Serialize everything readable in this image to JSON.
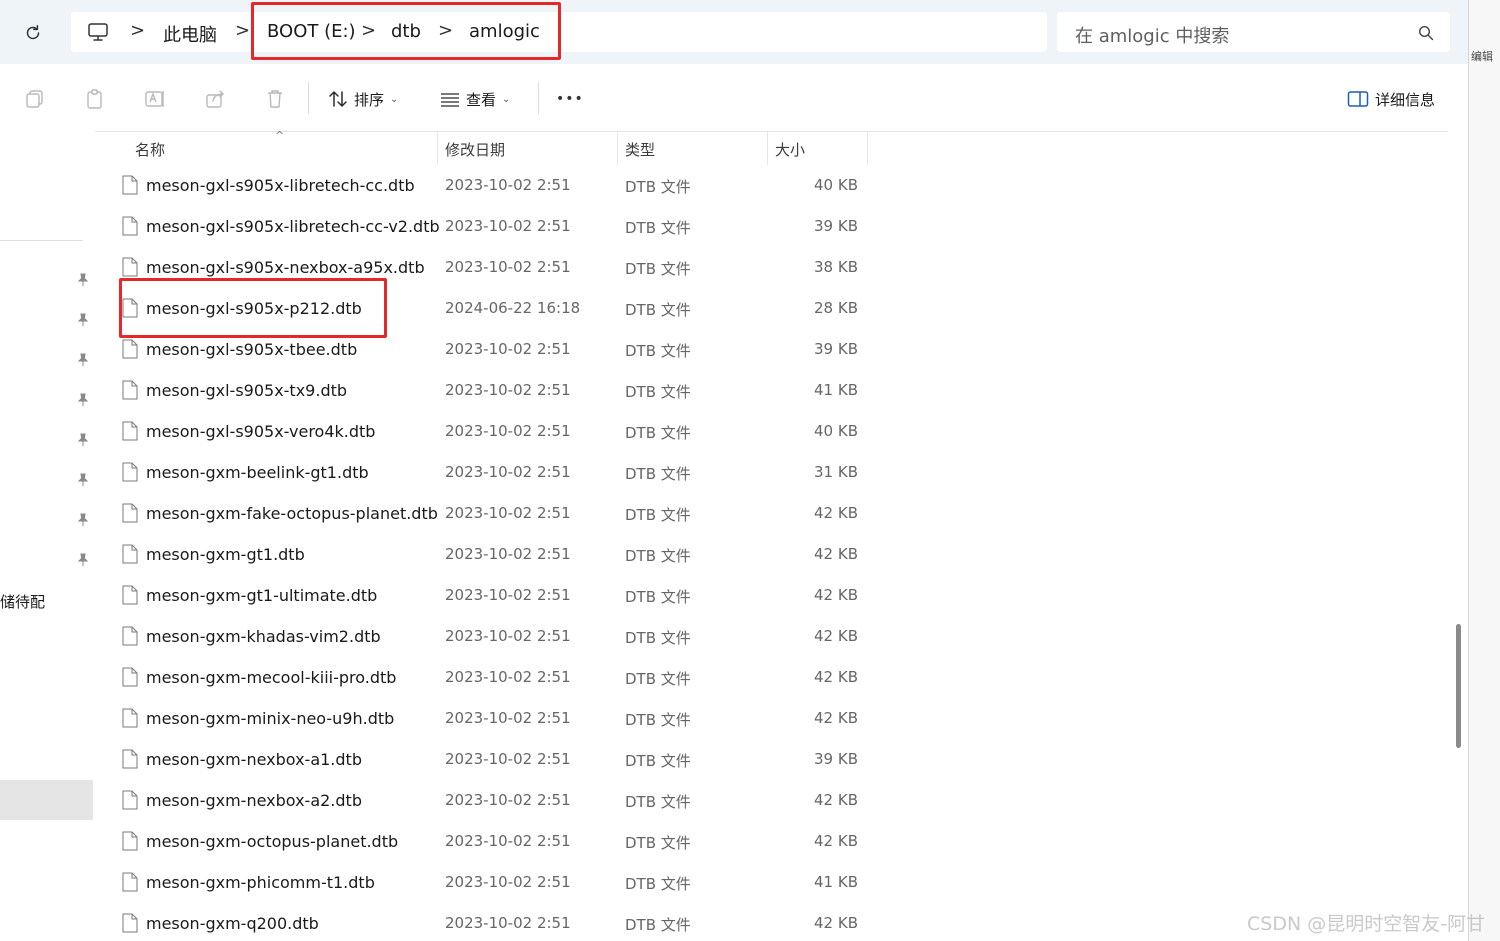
{
  "address_bar": {
    "breadcrumbs": [
      "此电脑",
      "BOOT (E:)",
      "dtb",
      "amlogic"
    ],
    "separator": ">"
  },
  "search": {
    "placeholder": "在 amlogic 中搜索"
  },
  "right_edge_label": "编辑",
  "toolbar": {
    "sort_label": "排序",
    "view_label": "查看",
    "more_label": "•••",
    "details_label": "详细信息"
  },
  "sidebar": {
    "partial_text": "储待配",
    "pinned_count": 8
  },
  "columns": {
    "name": "名称",
    "modified": "修改日期",
    "type": "类型",
    "size": "大小"
  },
  "files": [
    {
      "name": "meson-gxl-s905x-libretech-cc.dtb",
      "modified": "2023-10-02 2:51",
      "type": "DTB 文件",
      "size": "40 KB"
    },
    {
      "name": "meson-gxl-s905x-libretech-cc-v2.dtb",
      "modified": "2023-10-02 2:51",
      "type": "DTB 文件",
      "size": "39 KB"
    },
    {
      "name": "meson-gxl-s905x-nexbox-a95x.dtb",
      "modified": "2023-10-02 2:51",
      "type": "DTB 文件",
      "size": "38 KB"
    },
    {
      "name": "meson-gxl-s905x-p212.dtb",
      "modified": "2024-06-22 16:18",
      "type": "DTB 文件",
      "size": "28 KB",
      "highlighted": true
    },
    {
      "name": "meson-gxl-s905x-tbee.dtb",
      "modified": "2023-10-02 2:51",
      "type": "DTB 文件",
      "size": "39 KB"
    },
    {
      "name": "meson-gxl-s905x-tx9.dtb",
      "modified": "2023-10-02 2:51",
      "type": "DTB 文件",
      "size": "41 KB"
    },
    {
      "name": "meson-gxl-s905x-vero4k.dtb",
      "modified": "2023-10-02 2:51",
      "type": "DTB 文件",
      "size": "40 KB"
    },
    {
      "name": "meson-gxm-beelink-gt1.dtb",
      "modified": "2023-10-02 2:51",
      "type": "DTB 文件",
      "size": "31 KB"
    },
    {
      "name": "meson-gxm-fake-octopus-planet.dtb",
      "modified": "2023-10-02 2:51",
      "type": "DTB 文件",
      "size": "42 KB"
    },
    {
      "name": "meson-gxm-gt1.dtb",
      "modified": "2023-10-02 2:51",
      "type": "DTB 文件",
      "size": "42 KB"
    },
    {
      "name": "meson-gxm-gt1-ultimate.dtb",
      "modified": "2023-10-02 2:51",
      "type": "DTB 文件",
      "size": "42 KB"
    },
    {
      "name": "meson-gxm-khadas-vim2.dtb",
      "modified": "2023-10-02 2:51",
      "type": "DTB 文件",
      "size": "42 KB"
    },
    {
      "name": "meson-gxm-mecool-kiii-pro.dtb",
      "modified": "2023-10-02 2:51",
      "type": "DTB 文件",
      "size": "42 KB"
    },
    {
      "name": "meson-gxm-minix-neo-u9h.dtb",
      "modified": "2023-10-02 2:51",
      "type": "DTB 文件",
      "size": "42 KB"
    },
    {
      "name": "meson-gxm-nexbox-a1.dtb",
      "modified": "2023-10-02 2:51",
      "type": "DTB 文件",
      "size": "39 KB"
    },
    {
      "name": "meson-gxm-nexbox-a2.dtb",
      "modified": "2023-10-02 2:51",
      "type": "DTB 文件",
      "size": "42 KB"
    },
    {
      "name": "meson-gxm-octopus-planet.dtb",
      "modified": "2023-10-02 2:51",
      "type": "DTB 文件",
      "size": "42 KB"
    },
    {
      "name": "meson-gxm-phicomm-t1.dtb",
      "modified": "2023-10-02 2:51",
      "type": "DTB 文件",
      "size": "41 KB"
    },
    {
      "name": "meson-gxm-q200.dtb",
      "modified": "2023-10-02 2:51",
      "type": "DTB 文件",
      "size": "42 KB"
    }
  ],
  "watermark": "CSDN @昆明时空智友-阿甘",
  "colors": {
    "annotation_red": "#e8272b",
    "address_bar_bg": "#eff4f9",
    "accent_blue": "#1a5fb4"
  }
}
